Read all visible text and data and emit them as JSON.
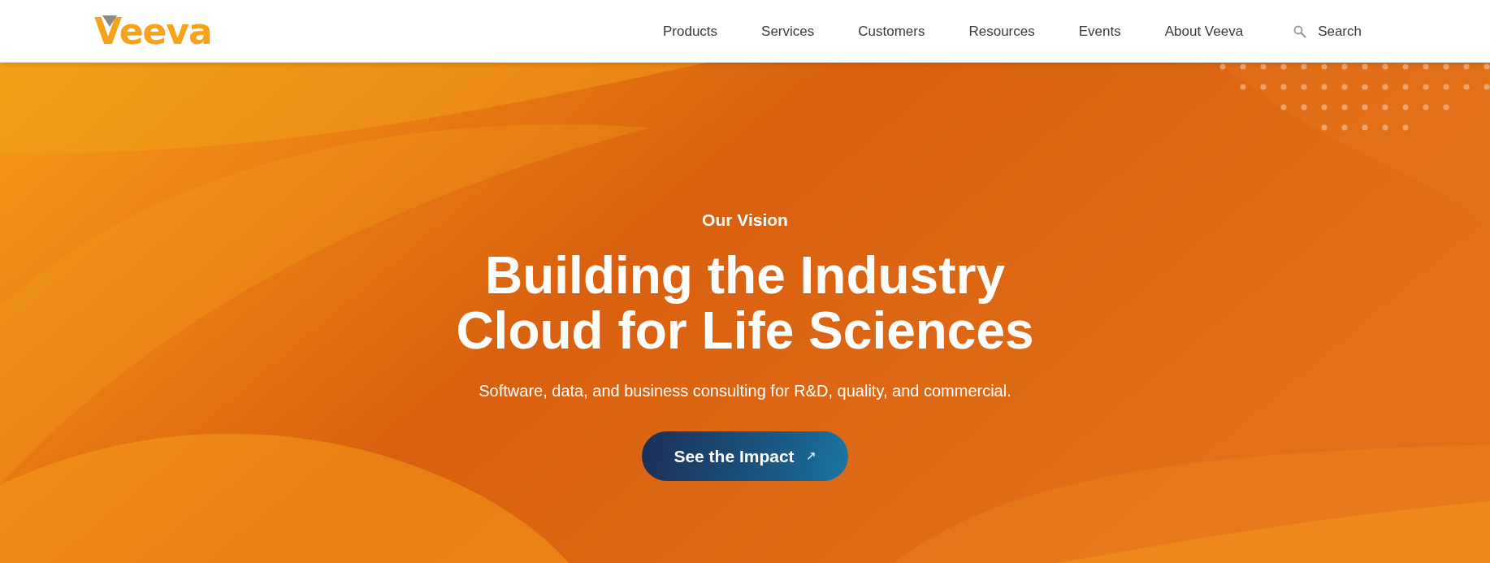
{
  "header": {
    "logo": "Veeva",
    "nav": [
      {
        "label": "Products"
      },
      {
        "label": "Services"
      },
      {
        "label": "Customers"
      },
      {
        "label": "Resources"
      },
      {
        "label": "Events"
      },
      {
        "label": "About Veeva"
      }
    ],
    "search": {
      "label": "Search"
    }
  },
  "hero": {
    "eyebrow": "Our Vision",
    "title_lines": [
      "Building the Industry",
      "Cloud for Life Sciences"
    ],
    "subtitle": "Software, data, and business consulting for R&D, quality, and commercial.",
    "button": {
      "label": "See the Impact",
      "icon": "↗"
    }
  }
}
